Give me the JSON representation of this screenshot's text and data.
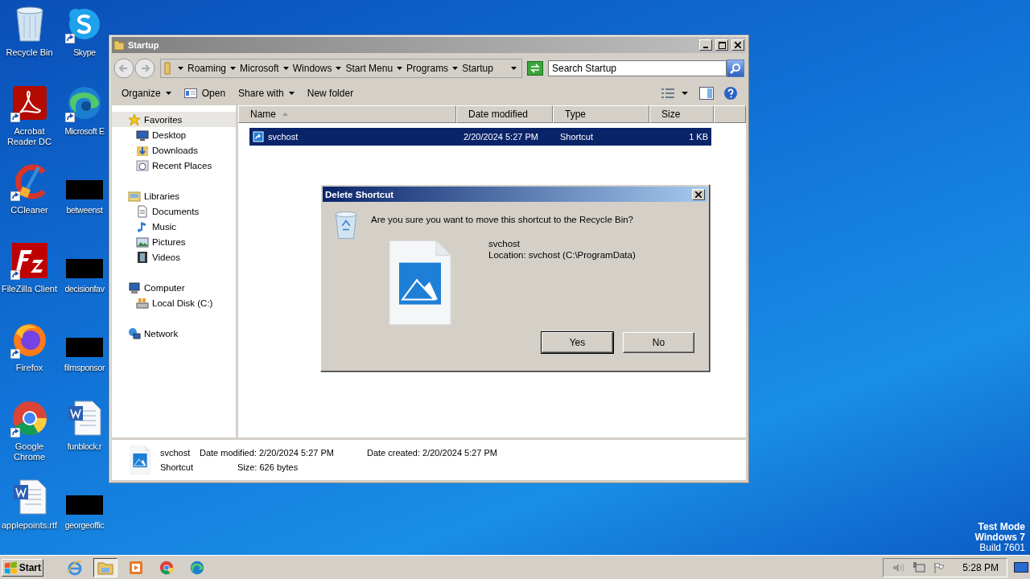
{
  "desktop_columns": [
    [
      {
        "label": "Recycle Bin",
        "kind": "recycle",
        "shortcut": false
      },
      {
        "label": "Acrobat Reader DC",
        "kind": "acrobat",
        "shortcut": true
      },
      {
        "label": "CCleaner",
        "kind": "ccleaner",
        "shortcut": true
      },
      {
        "label": "FileZilla Client",
        "kind": "filezilla",
        "shortcut": true
      },
      {
        "label": "Firefox",
        "kind": "firefox",
        "shortcut": true
      },
      {
        "label": "Google Chrome",
        "kind": "chrome",
        "shortcut": true
      },
      {
        "label": "applepoints.rtf",
        "kind": "word",
        "shortcut": false
      }
    ],
    [
      {
        "label": "Skype",
        "kind": "skype",
        "shortcut": true
      },
      {
        "label": "Microsoft E",
        "kind": "edge",
        "shortcut": true
      },
      {
        "label": "betweenst",
        "kind": "redacted",
        "shortcut": false
      },
      {
        "label": "decisionfav",
        "kind": "redacted",
        "shortcut": false
      },
      {
        "label": "filmsponsor",
        "kind": "redacted",
        "shortcut": false
      },
      {
        "label": "funblock.r",
        "kind": "word",
        "shortcut": false
      },
      {
        "label": "georgeoffic",
        "kind": "redacted",
        "shortcut": false
      }
    ]
  ],
  "explorer": {
    "title": "Startup",
    "breadcrumb": [
      "Roaming",
      "Microsoft",
      "Windows",
      "Start Menu",
      "Programs",
      "Startup"
    ],
    "search": {
      "placeholder": "Search Startup"
    },
    "toolbar": [
      {
        "label": "Organize",
        "kind": "plain",
        "dropdown": true
      },
      {
        "label": "Open",
        "kind": "open",
        "dropdown": false
      },
      {
        "label": "Share with",
        "kind": "plain",
        "dropdown": true
      },
      {
        "label": "New folder",
        "kind": "plain",
        "dropdown": false
      }
    ],
    "nav": [
      {
        "label": "Favorites",
        "kind": "star",
        "selected": true,
        "children": [
          {
            "label": "Desktop",
            "kind": "desktop",
            "selected": false
          },
          {
            "label": "Downloads",
            "kind": "downloads",
            "selected": false
          },
          {
            "label": "Recent Places",
            "kind": "recent",
            "selected": false
          }
        ]
      },
      {
        "label": "Libraries",
        "kind": "library",
        "selected": false,
        "children": [
          {
            "label": "Documents",
            "kind": "documents",
            "selected": false
          },
          {
            "label": "Music",
            "kind": "music",
            "selected": false
          },
          {
            "label": "Pictures",
            "kind": "pictures",
            "selected": false
          },
          {
            "label": "Videos",
            "kind": "videos",
            "selected": false
          }
        ]
      },
      {
        "label": "Computer",
        "kind": "computer",
        "selected": false,
        "children": [
          {
            "label": "Local Disk (C:)",
            "kind": "disk",
            "selected": false
          }
        ]
      },
      {
        "label": "Network",
        "kind": "network",
        "selected": false
      }
    ],
    "columns": [
      {
        "label": "Name",
        "sorted": true
      },
      {
        "label": "Date modified",
        "sorted": false
      },
      {
        "label": "Type",
        "sorted": false
      },
      {
        "label": "Size",
        "sorted": false
      }
    ],
    "rows": [
      {
        "name": "svchost",
        "date": "2/20/2024 5:27 PM",
        "type": "Shortcut",
        "size": "1 KB",
        "selected": true
      }
    ],
    "details": {
      "name": "svchost",
      "type": "Shortcut",
      "fields": [
        {
          "label": "Date modified:",
          "value": "2/20/2024 5:27 PM"
        },
        {
          "label": "Size:",
          "value": "626 bytes"
        },
        {
          "label": "Date created:",
          "value": "2/20/2024 5:27 PM"
        }
      ]
    }
  },
  "dialog": {
    "title": "Delete Shortcut",
    "message": "Are you sure you want to move this shortcut to the Recycle Bin?",
    "file_name": "svchost",
    "location": "Location: svchost (C:\\ProgramData)",
    "buttons": [
      {
        "label": "Yes",
        "default": true
      },
      {
        "label": "No",
        "default": false
      }
    ]
  },
  "system_text": [
    "Test Mode",
    "Windows 7",
    "Build 7601"
  ],
  "taskbar": {
    "start": "Start",
    "apps": [
      {
        "kind": "ie",
        "active": false
      },
      {
        "kind": "explorer",
        "active": true
      },
      {
        "kind": "media",
        "active": false
      },
      {
        "kind": "chrome",
        "active": false
      },
      {
        "kind": "edge",
        "active": false
      }
    ],
    "clock": "5:28 PM"
  }
}
